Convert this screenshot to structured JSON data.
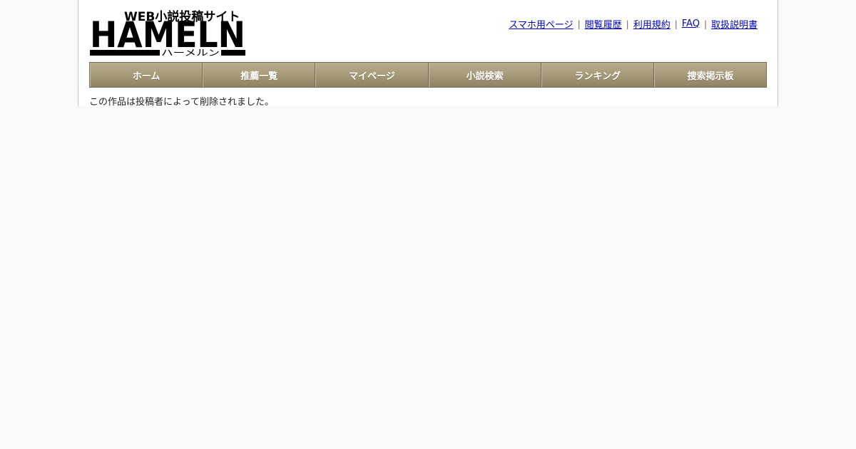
{
  "logo": {
    "tagline": "WEB小説投稿サイト",
    "wordmark": "HAMELN",
    "kana": "ハーメルン"
  },
  "top_links": [
    {
      "label": "スマホ用ページ"
    },
    {
      "label": "閲覧履歴"
    },
    {
      "label": "利用規約"
    },
    {
      "label": "FAQ"
    },
    {
      "label": "取扱説明書"
    }
  ],
  "separator": "|",
  "nav": [
    {
      "label": "ホーム"
    },
    {
      "label": "推薦一覧"
    },
    {
      "label": "マイページ"
    },
    {
      "label": "小説検索"
    },
    {
      "label": "ランキング"
    },
    {
      "label": "捜索掲示板"
    }
  ],
  "main": {
    "message": "この作品は投稿者によって削除されました。"
  }
}
